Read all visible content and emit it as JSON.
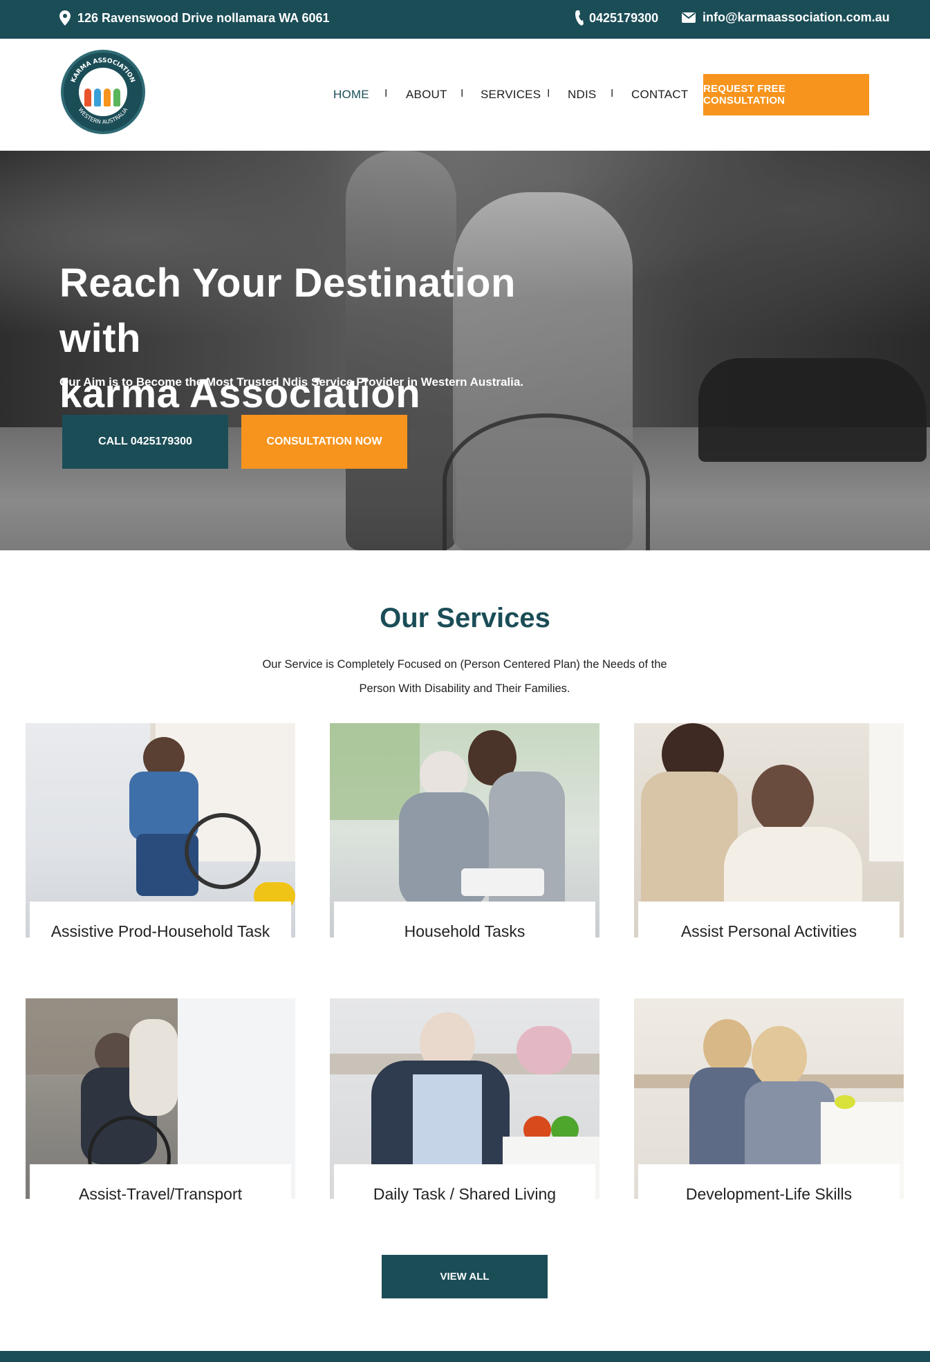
{
  "topbar": {
    "address": "126 Ravenswood Drive nollamara WA 6061",
    "phone": "0425179300",
    "email": "info@karmaassociation.com.au",
    "icons": [
      "location-pin-icon",
      "phone-icon",
      "envelope-icon"
    ]
  },
  "header": {
    "logo_text_top": "KARMA ASSOCIATION",
    "logo_text_bottom": "WESTERN AUSTRALIA",
    "nav": [
      {
        "label": "HOME"
      },
      {
        "label": "ABOUT"
      },
      {
        "label": "SERVICES"
      },
      {
        "label": "NDIS"
      },
      {
        "label": "CONTACT"
      }
    ],
    "separator": "I",
    "cta": "REQUEST FREE CONSULTATION"
  },
  "hero": {
    "title_line1": "Reach Your Destination with",
    "title_line2": "karma Association",
    "subtitle": "Our Aim is to Become the Most Trusted Ndis Service Provider in Western Australia.",
    "call_button": "CALL 0425179300",
    "consult_button": "CONSULTATION NOW"
  },
  "services": {
    "title": "Our Services",
    "description_line1": "Our Service is Completely Focused on (Person Centered Plan) the Needs of the",
    "description_line2": "Person With Disability and Their Families.",
    "items": [
      {
        "label": "Assistive Prod-Household Task"
      },
      {
        "label": "Household Tasks"
      },
      {
        "label": "Assist Personal Activities"
      },
      {
        "label": "Assist-Travel/Transport"
      },
      {
        "label": "Daily Task / Shared Living"
      },
      {
        "label": "Development-Life Skills"
      }
    ],
    "view_all": "VIEW ALL"
  },
  "colors": {
    "primary": "#1b4d57",
    "accent": "#f7941d",
    "white": "#ffffff"
  }
}
